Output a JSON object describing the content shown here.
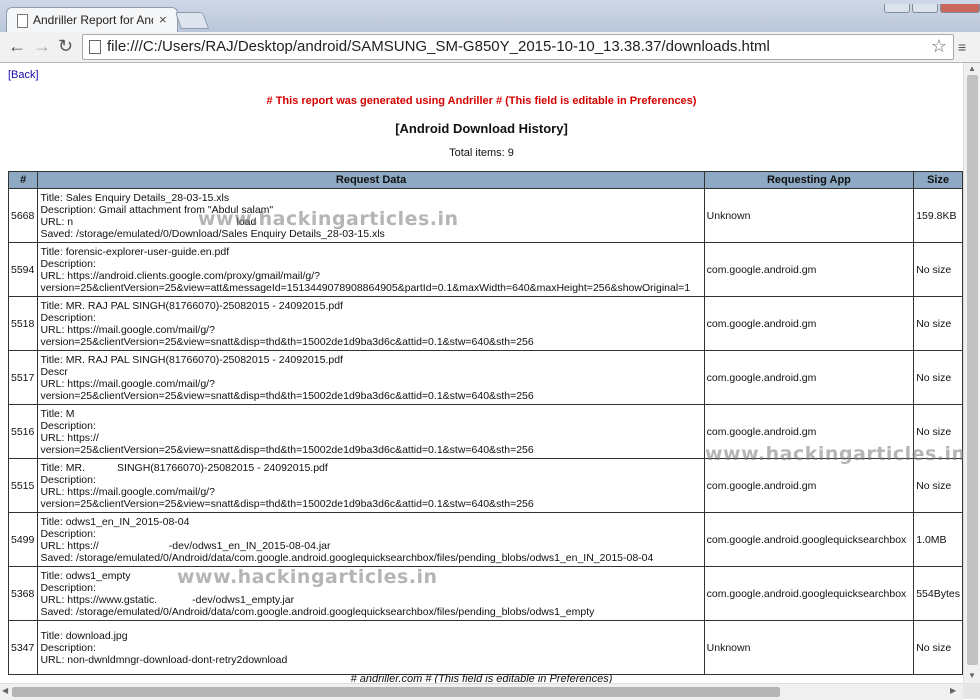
{
  "browser": {
    "tab_title": "Andriller Report for Andro",
    "tab_close": "×",
    "url": "file:///C:/Users/RAJ/Desktop/android/SAMSUNG_SM-G850Y_2015-10-10_13.38.37/downloads.html",
    "back_icon": "←",
    "forward_icon": "→",
    "reload_icon": "↻",
    "star_icon": "☆",
    "menu_icon": "≡"
  },
  "page": {
    "back_link": "[Back]",
    "notice": "# This report was generated using Andriller # (This field is editable in Preferences)",
    "heading": "[Android Download History]",
    "total": "Total items: 9",
    "footer": "# andriller.com # (This field is editable in Preferences)",
    "notice_color": "#d40000",
    "header_color": "#8da9c4"
  },
  "table": {
    "headers": [
      "#",
      "Request Data",
      "Requesting App",
      "Size"
    ],
    "rows": [
      {
        "id": "5668",
        "lines": [
          "Title: Sales Enquiry Details_28-03-15.xls",
          "Description: Gmail attachment from \"Abdul salam\"",
          "URL: n                                                        load",
          "Saved: /storage/emulated/0/Download/Sales Enquiry Details_28-03-15.xls"
        ],
        "app": "Unknown",
        "size": "159.8KB"
      },
      {
        "id": "5594",
        "lines": [
          "Title: forensic-explorer-user-guide.en.pdf",
          "Description:",
          "URL: https://android.clients.google.com/proxy/gmail/mail/g/?",
          "version=25&clientVersion=25&view=att&messageId=1513449078908864905&partId=0.1&maxWidth=640&maxHeight=256&showOriginal=1"
        ],
        "app": "com.google.android.gm",
        "size": "No size"
      },
      {
        "id": "5518",
        "lines": [
          "Title: MR. RAJ PAL SINGH(81766070)-25082015 - 24092015.pdf",
          "Description:",
          "URL: https://mail.google.com/mail/g/?",
          "version=25&clientVersion=25&view=snatt&disp=thd&th=15002de1d9ba3d6c&attid=0.1&stw=640&sth=256"
        ],
        "app": "com.google.android.gm",
        "size": "No size"
      },
      {
        "id": "5517",
        "lines": [
          "Title: MR. RAJ PAL SINGH(81766070)-25082015 - 24092015.pdf",
          "Descr",
          "URL: https://mail.google.com/mail/g/?",
          "version=25&clientVersion=25&view=snatt&disp=thd&th=15002de1d9ba3d6c&attid=0.1&stw=640&sth=256"
        ],
        "app": "com.google.android.gm",
        "size": "No size"
      },
      {
        "id": "5516",
        "lines": [
          "Title: M",
          "Description:",
          "URL: https://",
          "version=25&clientVersion=25&view=snatt&disp=thd&th=15002de1d9ba3d6c&attid=0.1&stw=640&sth=256"
        ],
        "app": "com.google.android.gm",
        "size": "No size"
      },
      {
        "id": "5515",
        "lines": [
          "Title: MR.           SINGH(81766070)-25082015 - 24092015.pdf",
          "Description:",
          "URL: https://mail.google.com/mail/g/?",
          "version=25&clientVersion=25&view=snatt&disp=thd&th=15002de1d9ba3d6c&attid=0.1&stw=640&sth=256"
        ],
        "app": "com.google.android.gm",
        "size": "No size"
      },
      {
        "id": "5499",
        "lines": [
          "Title: odws1_en_IN_2015-08-04",
          "Description:",
          "URL: https://                        -dev/odws1_en_IN_2015-08-04.jar",
          "Saved: /storage/emulated/0/Android/data/com.google.android.googlequicksearchbox/files/pending_blobs/odws1_en_IN_2015-08-04"
        ],
        "app": "com.google.android.googlequicksearchbox",
        "size": "1.0MB"
      },
      {
        "id": "5368",
        "lines": [
          "Title: odws1_empty",
          "Description:",
          "URL: https://www.gstatic.            -dev/odws1_empty.jar",
          "Saved: /storage/emulated/0/Android/data/com.google.android.googlequicksearchbox/files/pending_blobs/odws1_empty"
        ],
        "app": "com.google.android.googlequicksearchbox",
        "size": "554Bytes"
      },
      {
        "id": "5347",
        "lines": [
          "Title: download.jpg",
          "Description:",
          "URL: non-dwnldmngr-download-dont-retry2download"
        ],
        "app": "Unknown",
        "size": "No size"
      }
    ]
  },
  "watermark": "www.hackingarticles.in"
}
